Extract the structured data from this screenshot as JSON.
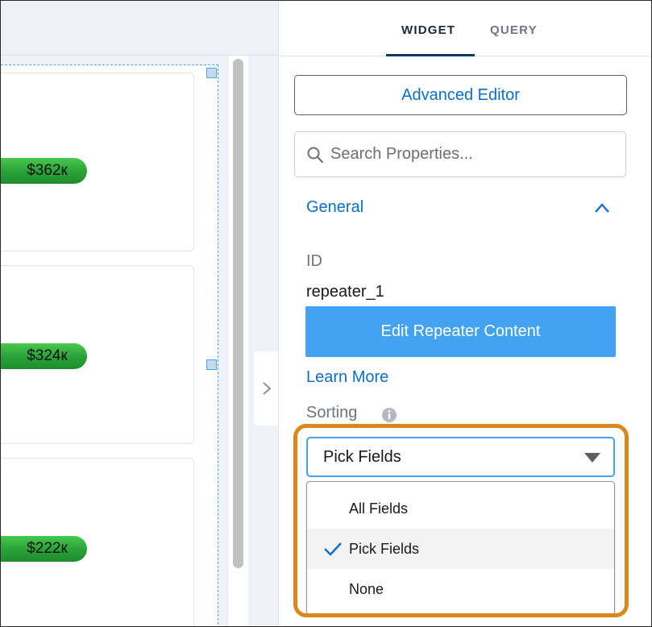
{
  "canvas": {
    "cards": [
      {
        "value": "$362к"
      },
      {
        "value": "$324к"
      },
      {
        "value": "$222к"
      }
    ]
  },
  "panel": {
    "tabs": [
      {
        "label": "WIDGET",
        "active": true
      },
      {
        "label": "QUERY",
        "active": false
      }
    ],
    "advanced_editor_label": "Advanced Editor",
    "search": {
      "placeholder": "Search Properties...",
      "value": ""
    },
    "section": {
      "label": "General",
      "expanded": true
    },
    "id_label": "ID",
    "id_value": "repeater_1",
    "edit_button_label": "Edit Repeater Content",
    "learn_more_label": "Learn More",
    "sorting_label": "Sorting",
    "sorting_select": {
      "selected": "Pick Fields",
      "options": [
        "All Fields",
        "Pick Fields",
        "None"
      ]
    }
  },
  "colors": {
    "accent": "#0b6fc9",
    "button_fill": "#43a3f2",
    "highlight": "#d8881c",
    "pill_green": "#2ba33a"
  },
  "icons": [
    "search-icon",
    "chevron-up-icon",
    "chevron-right-icon",
    "info-icon",
    "checkmark-icon",
    "caret-down-icon"
  ]
}
